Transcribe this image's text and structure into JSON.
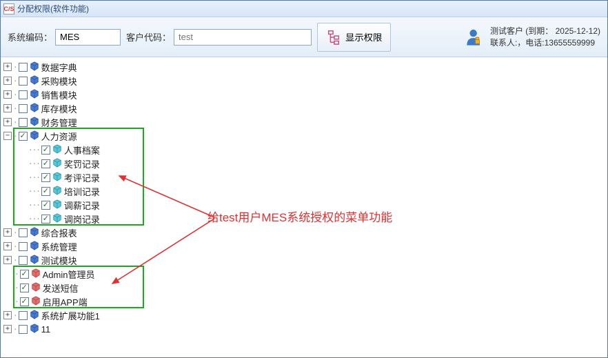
{
  "window": {
    "title": "分配权限(软件功能)",
    "icon_text": "C/S"
  },
  "toolbar": {
    "syscode_label": "系统编码：",
    "syscode_value": "MES",
    "custcode_label": "客户代码：",
    "custcode_placeholder": "test",
    "showperm_label": "显示权限"
  },
  "user": {
    "line1": "测试客户 (到期： 2025-12-12)",
    "line2": "联系人:，电话:13655559999"
  },
  "annotation": {
    "text": "给test用户MES系统授权的菜单功能"
  },
  "tree": [
    {
      "level": 0,
      "expander": "+",
      "checked": false,
      "icon": "cube-blue",
      "label": "数据字典"
    },
    {
      "level": 0,
      "expander": "+",
      "checked": false,
      "icon": "cube-blue",
      "label": "采购模块"
    },
    {
      "level": 0,
      "expander": "+",
      "checked": false,
      "icon": "cube-blue",
      "label": "销售模块"
    },
    {
      "level": 0,
      "expander": "+",
      "checked": false,
      "icon": "cube-blue",
      "label": "库存模块"
    },
    {
      "level": 0,
      "expander": "+",
      "checked": false,
      "icon": "cube-blue",
      "label": "财务管理"
    },
    {
      "level": 0,
      "expander": "-",
      "checked": true,
      "icon": "cube-blue",
      "label": "人力资源"
    },
    {
      "level": 1,
      "expander": "",
      "checked": true,
      "icon": "cube-cyan",
      "label": "人事档案"
    },
    {
      "level": 1,
      "expander": "",
      "checked": true,
      "icon": "cube-cyan",
      "label": "奖罚记录"
    },
    {
      "level": 1,
      "expander": "",
      "checked": true,
      "icon": "cube-cyan",
      "label": "考评记录"
    },
    {
      "level": 1,
      "expander": "",
      "checked": true,
      "icon": "cube-cyan",
      "label": "培训记录"
    },
    {
      "level": 1,
      "expander": "",
      "checked": true,
      "icon": "cube-cyan",
      "label": "调薪记录"
    },
    {
      "level": 1,
      "expander": "",
      "checked": true,
      "icon": "cube-cyan",
      "label": "调岗记录"
    },
    {
      "level": 0,
      "expander": "+",
      "checked": false,
      "icon": "cube-blue",
      "label": "综合报表"
    },
    {
      "level": 0,
      "expander": "+",
      "checked": false,
      "icon": "cube-blue",
      "label": "系统管理"
    },
    {
      "level": 0,
      "expander": "+",
      "checked": false,
      "icon": "cube-blue",
      "label": "测试模块"
    },
    {
      "level": 0,
      "expander": "",
      "checked": true,
      "icon": "cube-red",
      "label": "Admin管理员"
    },
    {
      "level": 0,
      "expander": "",
      "checked": true,
      "icon": "cube-red",
      "label": "发送短信"
    },
    {
      "level": 0,
      "expander": "",
      "checked": true,
      "icon": "cube-red",
      "label": "启用APP端"
    },
    {
      "level": 0,
      "expander": "+",
      "checked": false,
      "icon": "cube-blue",
      "label": "系统扩展功能1"
    },
    {
      "level": 0,
      "expander": "+",
      "checked": false,
      "icon": "cube-blue",
      "label": "11"
    }
  ]
}
